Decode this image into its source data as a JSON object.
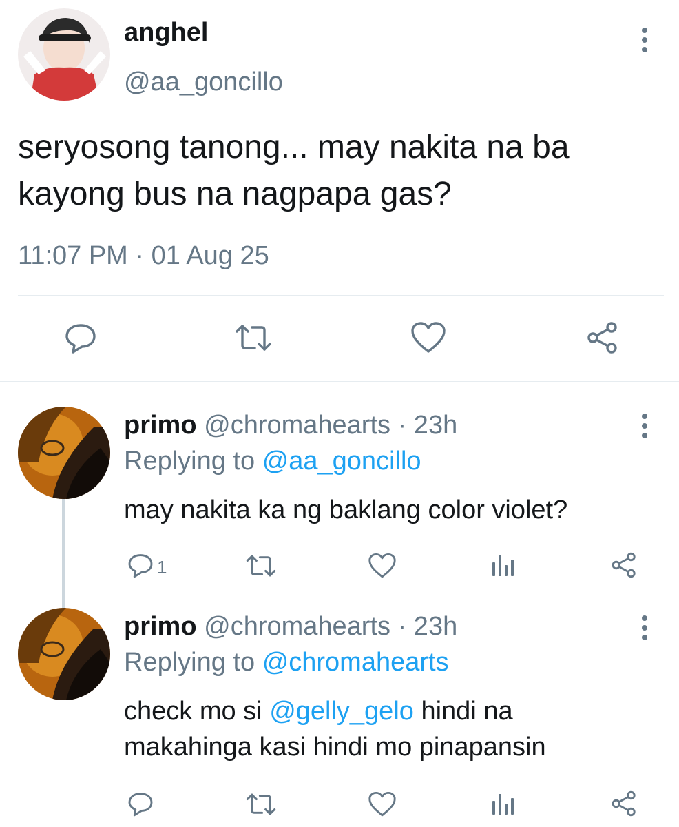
{
  "main_tweet": {
    "display_name": "anghel",
    "handle": "@aa_goncillo",
    "text": "seryosong tanong... may nakita na ba kayong bus na nagpapa gas?",
    "timestamp": "11:07 PM · 01 Aug 25",
    "actions": [
      "reply-icon",
      "retweet-icon",
      "like-icon",
      "share-icon"
    ]
  },
  "replies": [
    {
      "display_name": "primo",
      "handle": "@chromahearts",
      "age": "· 23h",
      "replying_label": "Replying to",
      "replying_handle": "@aa_goncillo",
      "text": "may nakita ka ng baklang color violet?",
      "reply_count": "1"
    },
    {
      "display_name": "primo",
      "handle": "@chromahearts",
      "age": "· 23h",
      "replying_label": "Replying to",
      "replying_handle": "@chromahearts",
      "text_before": "check mo si",
      "mention": "@gelly_gelo",
      "text_line1_after": "hindi na",
      "text_line2": "makahinga kasi hindi mo pinapansin"
    }
  ],
  "colors": {
    "text": "#14171a",
    "muted": "#657786",
    "link": "#1da1f2",
    "divider": "#e6ecf0"
  }
}
